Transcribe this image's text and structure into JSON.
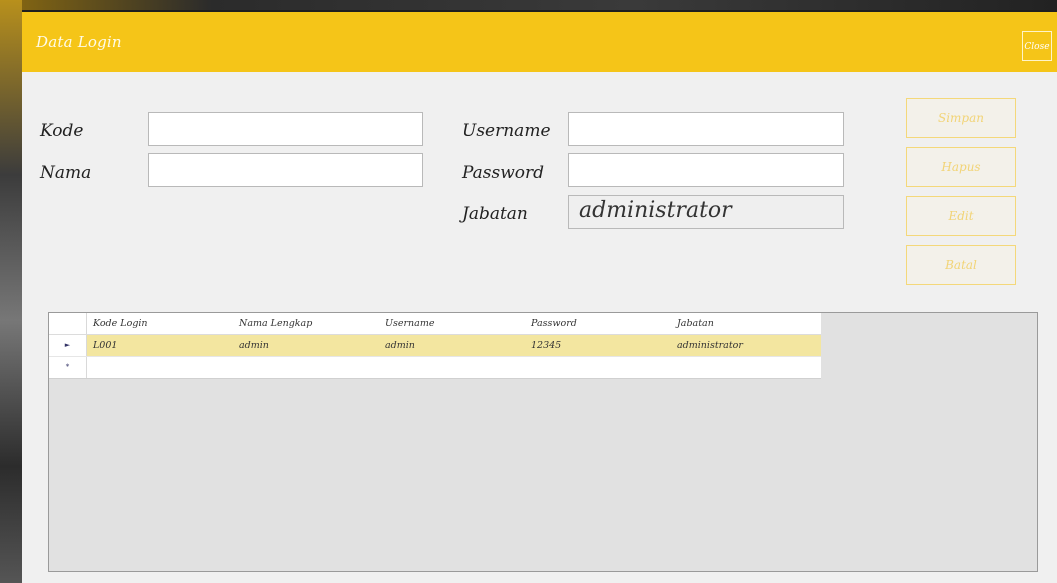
{
  "window": {
    "title": "Data Login",
    "close_label": "Close"
  },
  "form": {
    "kode": {
      "label": "Kode",
      "value": ""
    },
    "nama": {
      "label": "Nama",
      "value": ""
    },
    "username": {
      "label": "Username",
      "value": ""
    },
    "password": {
      "label": "Password",
      "value": ""
    },
    "jabatan": {
      "label": "Jabatan",
      "value": "administrator"
    }
  },
  "buttons": {
    "simpan": "Simpan",
    "hapus": "Hapus",
    "edit": "Edit",
    "batal": "Batal"
  },
  "grid": {
    "columns": [
      "Kode Login",
      "Nama Lengkap",
      "Username",
      "Password",
      "Jabatan"
    ],
    "rows": [
      [
        "L001",
        "admin",
        "admin",
        "12345",
        "administrator"
      ]
    ],
    "current_row_marker": "►",
    "new_row_marker": "*"
  },
  "colors": {
    "accent": "#f5c518",
    "selected_row": "#f3e6a0"
  }
}
